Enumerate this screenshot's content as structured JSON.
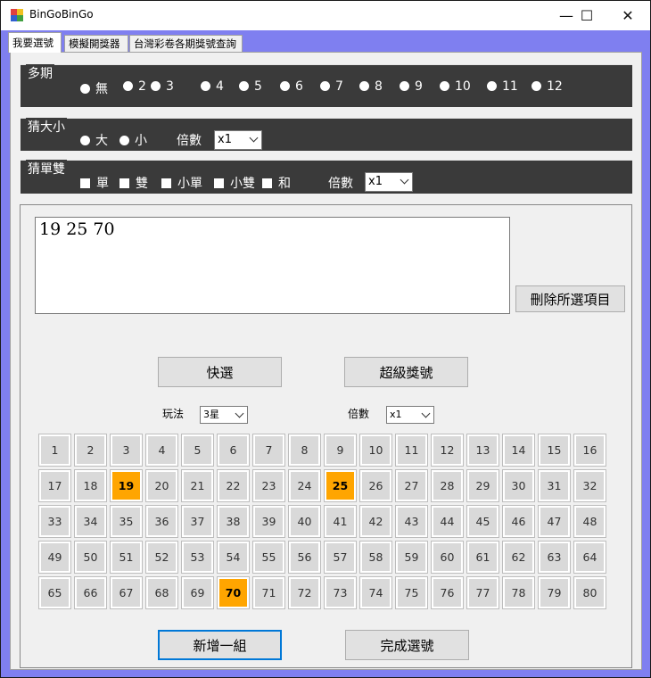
{
  "window": {
    "title": "BinGoBinGo",
    "minimize": "—",
    "maximize": "☐",
    "close": "✕"
  },
  "tabs": [
    "我要選號",
    "模擬開獎器",
    "台灣彩卷各期獎號查詢"
  ],
  "multi_period": {
    "title": "多期",
    "options": [
      "無",
      "2",
      "3",
      "4",
      "5",
      "6",
      "7",
      "8",
      "9",
      "10",
      "11",
      "12"
    ]
  },
  "big_small": {
    "title": "猜大小",
    "options": [
      "大",
      "小"
    ],
    "multiplier_label": "倍數",
    "multiplier_value": "x1"
  },
  "odd_even": {
    "title": "猜單雙",
    "options": [
      "單",
      "雙",
      "小單",
      "小雙",
      "和"
    ],
    "multiplier_label": "倍數",
    "multiplier_value": "x1"
  },
  "selected_text": "19  25  70",
  "buttons": {
    "delete": "刪除所選項目",
    "quick_pick": "快選",
    "super_number": "超級獎號",
    "add_group": "新增一組",
    "done": "完成選號"
  },
  "play_label": "玩法",
  "play_value": "3星",
  "multiplier_label": "倍數",
  "multiplier_value": "x1",
  "numbers": [
    1,
    2,
    3,
    4,
    5,
    6,
    7,
    8,
    9,
    10,
    11,
    12,
    13,
    14,
    15,
    16,
    17,
    18,
    19,
    20,
    21,
    22,
    23,
    24,
    25,
    26,
    27,
    28,
    29,
    30,
    31,
    32,
    33,
    34,
    35,
    36,
    37,
    38,
    39,
    40,
    41,
    42,
    43,
    44,
    45,
    46,
    47,
    48,
    49,
    50,
    51,
    52,
    53,
    54,
    55,
    56,
    57,
    58,
    59,
    60,
    61,
    62,
    63,
    64,
    65,
    66,
    67,
    68,
    69,
    70,
    71,
    72,
    73,
    74,
    75,
    76,
    77,
    78,
    79,
    80
  ],
  "selected_numbers": [
    19,
    25,
    70
  ],
  "colors": {
    "highlight": "#ffa500",
    "panel": "#3a3a3a",
    "window_bg": "#7f7ff0"
  }
}
